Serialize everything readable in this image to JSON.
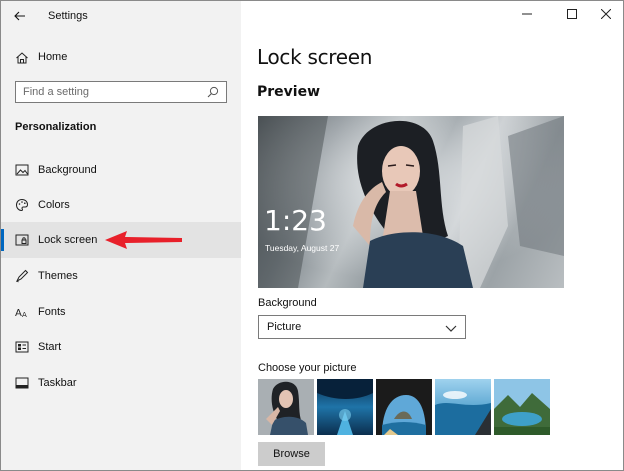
{
  "window": {
    "title": "Settings",
    "controls": [
      "minimize",
      "maximize",
      "close"
    ]
  },
  "sidebar": {
    "home_label": "Home",
    "search_placeholder": "Find a setting",
    "section_title": "Personalization",
    "items": [
      {
        "label": "Background",
        "icon": "picture-icon"
      },
      {
        "label": "Colors",
        "icon": "palette-icon"
      },
      {
        "label": "Lock screen",
        "icon": "lock-screen-icon",
        "active": true
      },
      {
        "label": "Themes",
        "icon": "themes-icon"
      },
      {
        "label": "Fonts",
        "icon": "fonts-icon"
      },
      {
        "label": "Start",
        "icon": "start-icon"
      },
      {
        "label": "Taskbar",
        "icon": "taskbar-icon"
      }
    ]
  },
  "main": {
    "page_title": "Lock screen",
    "preview_title": "Preview",
    "preview": {
      "time": "1:23",
      "date": "Tuesday, August 27"
    },
    "background_label": "Background",
    "background_value": "Picture",
    "choose_picture_label": "Choose your picture",
    "thumbnails": [
      "woman-portrait",
      "ice-cave",
      "sea-arch",
      "ocean-aerial",
      "mountain-lake"
    ],
    "browse_label": "Browse"
  },
  "colors": {
    "sidebar_bg": "#f2f2f2",
    "active_item_bg": "#e3e3e3",
    "accent": "#0067c0",
    "annotation_arrow": "#e8202a",
    "button_bg": "#cccccc"
  }
}
